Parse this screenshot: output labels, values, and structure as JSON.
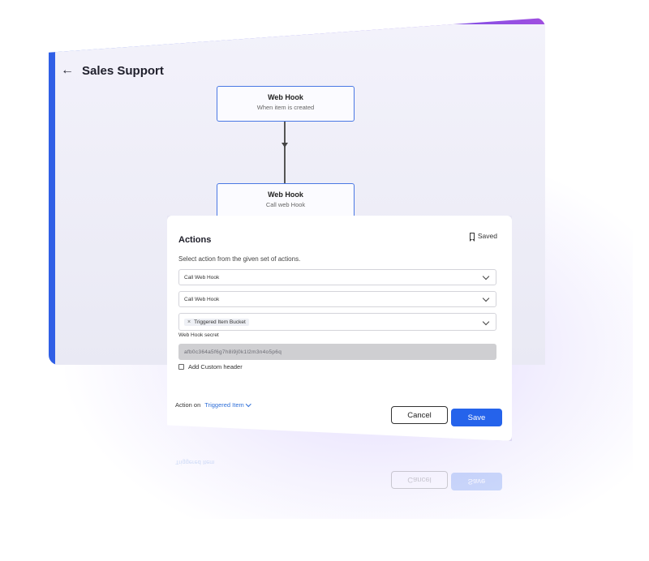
{
  "page": {
    "title": "Sales Support",
    "accent": "#2563eb"
  },
  "flow": {
    "nodes": [
      {
        "title": "Web Hook",
        "subtitle": "When item is created"
      },
      {
        "title": "Web Hook",
        "subtitle": "Call web Hook"
      }
    ]
  },
  "actions_panel": {
    "title": "Actions",
    "saved_label": "Saved",
    "instruction": "Select action from the given set of actions.",
    "selects": [
      {
        "value": "Call Web Hook"
      },
      {
        "value": "Call Web Hook"
      }
    ],
    "chip_select": {
      "chip_label": "Triggered Item Bucket"
    },
    "secret_label": "Web Hook secret",
    "secret_value": "afb0c364a5f6g7h8i9j0k1l2m3n4o5p6q",
    "custom_header_label": "Add Custom header",
    "action_on_label": "Action on",
    "action_on_value": "Triggered Item",
    "cancel_label": "Cancel",
    "save_label": "Save"
  }
}
